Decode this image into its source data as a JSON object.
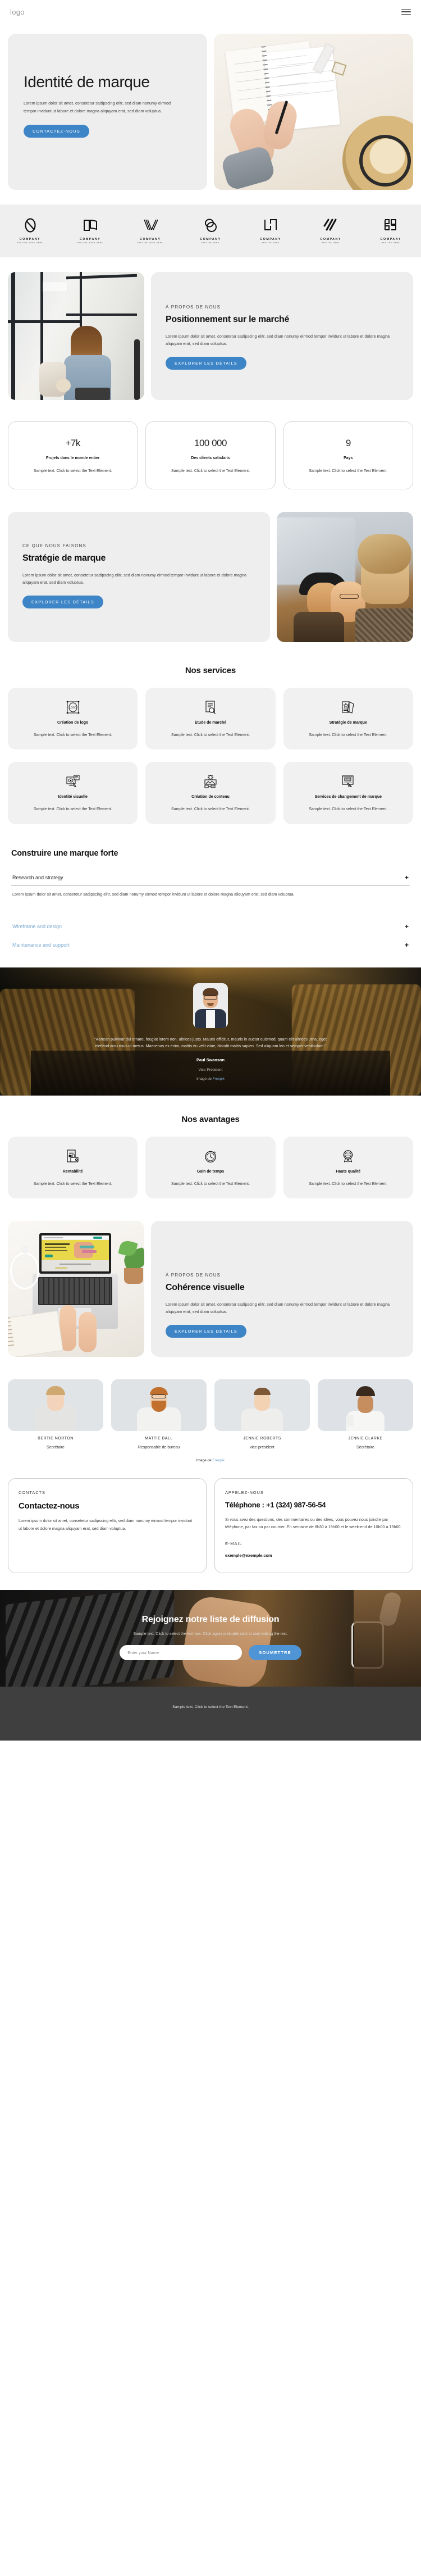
{
  "header": {
    "logo": "logo",
    "menu_icon": "hamburger-menu"
  },
  "hero": {
    "title": "Identité de marque",
    "paragraph": "Lorem ipsum dolor sit amet, consetetur sadipscing elitr, sed diam nonumy eirmod tempor invidunt ut labore et dolore magna aliquyam erat, sed diam voluptua.",
    "cta": "CONTACTEZ-NOUS"
  },
  "logos": [
    {
      "name": "COMPANY",
      "tagline": "TAGLINE GOES HERE"
    },
    {
      "name": "COMPANY",
      "tagline": "TAGLINE GOES HERE"
    },
    {
      "name": "COMPANY",
      "tagline": "TAGLINE GOES HERE"
    },
    {
      "name": "COMPANY",
      "tagline": "TAGLINE HERE"
    },
    {
      "name": "COMPANY",
      "tagline": "TAGLINE HERE"
    },
    {
      "name": "COMPANY",
      "tagline": "TAGLINE HERE"
    },
    {
      "name": "COMPANY",
      "tagline": "TAGLINE HERE"
    }
  ],
  "about_market": {
    "eyebrow": "À PROPOS DE NOUS",
    "title": "Positionnement sur le marché",
    "paragraph": "Lorem ipsum dolor sit amet, consetetur sadipscing elitr, sed diam nonumy eirmod tempor invidunt ut labore et dolore magna aliquyam erat, sed diam voluptua.",
    "cta": "EXPLORER LES DÉTAILS"
  },
  "stats": [
    {
      "number": "+7k",
      "label": "Projets dans le monde entier",
      "desc": "Sample text. Click to select the Text Element."
    },
    {
      "number": "100 000",
      "label": "Des clients satisfaits",
      "desc": "Sample text. Click to select the Text Element."
    },
    {
      "number": "9",
      "label": "Pays",
      "desc": "Sample text. Click to select the Text Element."
    }
  ],
  "strategy": {
    "eyebrow": "CE QUE NOUS FAISONS",
    "title": "Stratégie de marque",
    "paragraph": "Lorem ipsum dolor sit amet, consetetur sadipscing elitr, sed diam nonumy eirmod tempor invidunt ut labore et dolore magna aliquyam erat, sed diam voluptua.",
    "cta": "EXPLORER LES DÉTAILS"
  },
  "services": {
    "title": "Nos services",
    "items": [
      {
        "icon": "logo-design-icon",
        "title": "Création de logo",
        "desc": "Sample text. Click to select the Text Element."
      },
      {
        "icon": "market-research-icon",
        "title": "Étude de marché",
        "desc": "Sample text. Click to select the Text Element."
      },
      {
        "icon": "brand-strategy-icon",
        "title": "Stratégie de marque",
        "desc": "Sample text. Click to select the Text Element."
      },
      {
        "icon": "visual-identity-icon",
        "title": "Identité visuelle",
        "desc": "Sample text. Click to select the Text Element."
      },
      {
        "icon": "content-creation-icon",
        "title": "Création de contenu",
        "desc": "Sample text. Click to select the Text Element."
      },
      {
        "icon": "rebranding-icon",
        "title": "Services de changement de marque",
        "desc": "Sample text. Click to select the Text Element."
      }
    ]
  },
  "accordion": {
    "title": "Construire une marque forte",
    "items": [
      {
        "label": "Research and strategy",
        "open": true,
        "body": "Lorem ipsum dolor sit amet, consetetur sadipscing elitr, sed diam nonumy eirmod tempor invidunt ut labore et dolore magna aliquyam erat, sed diam voluptua.",
        "toggle": "+"
      },
      {
        "label": "Wireframe and design",
        "open": false,
        "body": "",
        "toggle": "+"
      },
      {
        "label": "Maintenance and support",
        "open": false,
        "body": "",
        "toggle": "+"
      }
    ]
  },
  "testimonial": {
    "quote": "\"Aenean pulvinar dui ornare, feugiat lorem non, ultrices justo. Mauris efficitur, mauris in auctor euismod, quam elit ultrices urna, eget eleifend arcu risus id metus. Maecenas ex enim, mattis eu velit vitae, blandit mattis sapien. Sed aliquam leo et semper vestibulum.\"",
    "name": "Paul Swanson",
    "role": "Vice-Président",
    "credit_prefix": "Image de ",
    "credit_link": "Freepik"
  },
  "advantages": {
    "title": "Nos avantages",
    "items": [
      {
        "icon": "cost-efficiency-icon",
        "title": "Rentabilité",
        "desc": "Sample text. Click to select the Text Element."
      },
      {
        "icon": "time-saving-icon",
        "title": "Gain de temps",
        "desc": "Sample text. Click to select the Text Element."
      },
      {
        "icon": "high-quality-icon",
        "title": "Haute qualité",
        "desc": "Sample text. Click to select the Text Element."
      }
    ]
  },
  "visual_consistency": {
    "eyebrow": "À PROPOS DE NOUS",
    "title": "Cohérence visuelle",
    "paragraph": "Lorem ipsum dolor sit amet, consetetur sadipscing elitr, sed diam nonumy eirmod tempor invidunt ut labore et dolore magna aliquyam erat, sed diam voluptua.",
    "cta": "EXPLORER LES DÉTAILS"
  },
  "team": {
    "members": [
      {
        "name": "BERTIE NORTON",
        "role": "Secrétaire"
      },
      {
        "name": "MATTIE BALL",
        "role": "Responsable de bureau"
      },
      {
        "name": "JENNIE ROBERTS",
        "role": "vice-président"
      },
      {
        "name": "JENNIE CLARKE",
        "role": "Secrétaire"
      }
    ],
    "credit_prefix": "Image de ",
    "credit_link": "Freepik"
  },
  "contact": {
    "left": {
      "eyebrow": "CONTACTS",
      "title": "Contactez-nous",
      "paragraph": "Lorem ipsum dolor sit amet, consetetur sadipscing elitr, sed diam nonumy eirmod tempor invidunt ut labore et dolore magna aliquyam erat, sed diam voluptua."
    },
    "right": {
      "eyebrow": "APPELEZ-NOUS",
      "title": "Téléphone : +1 (324) 987-56-54",
      "paragraph": "Si vous avez des questions, des commentaires ou des idées, vous pouvez nous joindre par téléphone, par fax ou par courrier. En semaine de 8h30 à 19h00 et le week-end de 10h00 à 19h00.",
      "email_label": "E-MAIL",
      "email": "exemple@exemple.com"
    }
  },
  "newsletter": {
    "title": "Rejoignez notre liste de diffusion",
    "subtitle": "Sample text. Click to select the text box. Click again or double click to start editing the text.",
    "input_placeholder": "Enter your Name",
    "submit": "SOUMETTRE"
  },
  "footer": {
    "text": "Sample text. Click to select the Text Element."
  },
  "colors": {
    "accent": "#3d85c6",
    "accent_light": "#4f94d4",
    "grey_card": "#eeeeee",
    "footer_bg": "#3f3f3f"
  }
}
